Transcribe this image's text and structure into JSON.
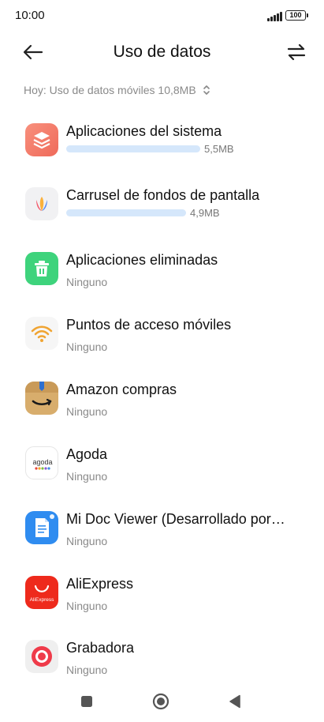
{
  "status_bar": {
    "time": "10:00",
    "battery": "100",
    "signal_icon": "signal-bars-icon",
    "battery_icon": "battery-icon"
  },
  "header": {
    "title": "Uso de datos",
    "back_icon": "arrow-left-icon",
    "swap_icon": "swap-arrows-icon"
  },
  "filter": {
    "label": "Hoy: Uso de datos móviles 10,8MB",
    "chevron_icon": "chevron-up-down-icon"
  },
  "apps": [
    {
      "name": "Aplicaciones del sistema",
      "usage": "5,5MB",
      "usage_fraction": 1.0,
      "icon": "system-apps-icon",
      "icon_color": "#f47d6c"
    },
    {
      "name": "Carrusel de fondos de pantalla",
      "usage": "4,9MB",
      "usage_fraction": 0.89,
      "icon": "wallpaper-carousel-icon",
      "icon_color": "#f2f2f2"
    },
    {
      "name": "Aplicaciones eliminadas",
      "subtitle": "Ninguno",
      "icon": "trash-icon",
      "icon_color": "#3dd07a"
    },
    {
      "name": "Puntos de acceso móviles",
      "subtitle": "Ninguno",
      "icon": "wifi-hotspot-icon",
      "icon_color": "#f7f7f7"
    },
    {
      "name": "Amazon compras",
      "subtitle": "Ninguno",
      "icon": "amazon-icon",
      "icon_color": "#d9b070"
    },
    {
      "name": "Agoda",
      "subtitle": "Ninguno",
      "icon": "agoda-icon",
      "icon_color": "#ffffff",
      "logo_text": "agoda"
    },
    {
      "name": "Mi Doc Viewer (Desarrollado por…",
      "subtitle": "Ninguno",
      "icon": "document-viewer-icon",
      "icon_color": "#2f8cf0"
    },
    {
      "name": "AliExpress",
      "subtitle": "Ninguno",
      "icon": "aliexpress-icon",
      "icon_color": "#ee2a1c",
      "logo_text": "AliExpress"
    },
    {
      "name": "Grabadora",
      "subtitle": "Ninguno",
      "icon": "recorder-icon",
      "icon_color": "#f0f0f0"
    }
  ],
  "navbar": {
    "recents_icon": "square-recents-icon",
    "home_icon": "circle-home-icon",
    "back_icon": "triangle-back-icon"
  }
}
